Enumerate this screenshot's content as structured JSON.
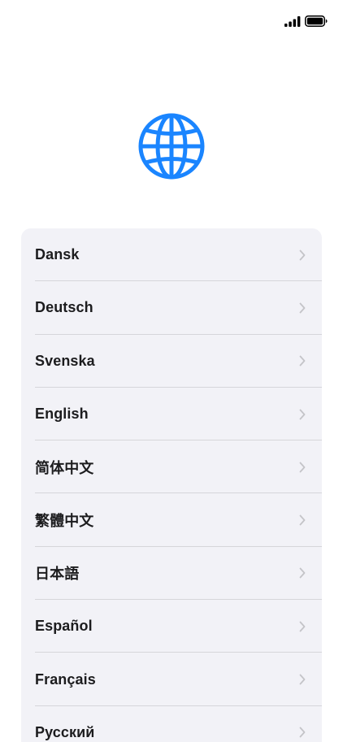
{
  "status_bar": {
    "signal_icon": "cellular-signal-icon",
    "battery_icon": "battery-full-icon"
  },
  "header": {
    "icon": "globe-icon",
    "accent_color": "#1a85ff"
  },
  "languages": [
    {
      "label": "Dansk"
    },
    {
      "label": "Deutsch"
    },
    {
      "label": "Svenska"
    },
    {
      "label": "English"
    },
    {
      "label": "简体中文"
    },
    {
      "label": "繁體中文"
    },
    {
      "label": "日本語"
    },
    {
      "label": "Español"
    },
    {
      "label": "Français"
    },
    {
      "label": "Русский"
    }
  ],
  "colors": {
    "list_background": "#f2f2f7",
    "text": "#1c1c1e",
    "chevron": "#c4c4c8"
  }
}
